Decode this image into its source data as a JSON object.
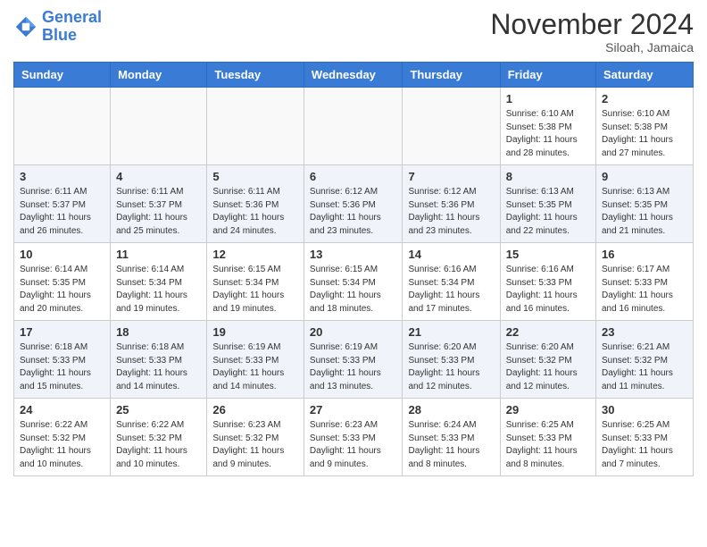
{
  "header": {
    "logo_line1": "General",
    "logo_line2": "Blue",
    "month_title": "November 2024",
    "subtitle": "Siloah, Jamaica"
  },
  "weekdays": [
    "Sunday",
    "Monday",
    "Tuesday",
    "Wednesday",
    "Thursday",
    "Friday",
    "Saturday"
  ],
  "weeks": [
    [
      {
        "day": "",
        "info": ""
      },
      {
        "day": "",
        "info": ""
      },
      {
        "day": "",
        "info": ""
      },
      {
        "day": "",
        "info": ""
      },
      {
        "day": "",
        "info": ""
      },
      {
        "day": "1",
        "info": "Sunrise: 6:10 AM\nSunset: 5:38 PM\nDaylight: 11 hours\nand 28 minutes."
      },
      {
        "day": "2",
        "info": "Sunrise: 6:10 AM\nSunset: 5:38 PM\nDaylight: 11 hours\nand 27 minutes."
      }
    ],
    [
      {
        "day": "3",
        "info": "Sunrise: 6:11 AM\nSunset: 5:37 PM\nDaylight: 11 hours\nand 26 minutes."
      },
      {
        "day": "4",
        "info": "Sunrise: 6:11 AM\nSunset: 5:37 PM\nDaylight: 11 hours\nand 25 minutes."
      },
      {
        "day": "5",
        "info": "Sunrise: 6:11 AM\nSunset: 5:36 PM\nDaylight: 11 hours\nand 24 minutes."
      },
      {
        "day": "6",
        "info": "Sunrise: 6:12 AM\nSunset: 5:36 PM\nDaylight: 11 hours\nand 23 minutes."
      },
      {
        "day": "7",
        "info": "Sunrise: 6:12 AM\nSunset: 5:36 PM\nDaylight: 11 hours\nand 23 minutes."
      },
      {
        "day": "8",
        "info": "Sunrise: 6:13 AM\nSunset: 5:35 PM\nDaylight: 11 hours\nand 22 minutes."
      },
      {
        "day": "9",
        "info": "Sunrise: 6:13 AM\nSunset: 5:35 PM\nDaylight: 11 hours\nand 21 minutes."
      }
    ],
    [
      {
        "day": "10",
        "info": "Sunrise: 6:14 AM\nSunset: 5:35 PM\nDaylight: 11 hours\nand 20 minutes."
      },
      {
        "day": "11",
        "info": "Sunrise: 6:14 AM\nSunset: 5:34 PM\nDaylight: 11 hours\nand 19 minutes."
      },
      {
        "day": "12",
        "info": "Sunrise: 6:15 AM\nSunset: 5:34 PM\nDaylight: 11 hours\nand 19 minutes."
      },
      {
        "day": "13",
        "info": "Sunrise: 6:15 AM\nSunset: 5:34 PM\nDaylight: 11 hours\nand 18 minutes."
      },
      {
        "day": "14",
        "info": "Sunrise: 6:16 AM\nSunset: 5:34 PM\nDaylight: 11 hours\nand 17 minutes."
      },
      {
        "day": "15",
        "info": "Sunrise: 6:16 AM\nSunset: 5:33 PM\nDaylight: 11 hours\nand 16 minutes."
      },
      {
        "day": "16",
        "info": "Sunrise: 6:17 AM\nSunset: 5:33 PM\nDaylight: 11 hours\nand 16 minutes."
      }
    ],
    [
      {
        "day": "17",
        "info": "Sunrise: 6:18 AM\nSunset: 5:33 PM\nDaylight: 11 hours\nand 15 minutes."
      },
      {
        "day": "18",
        "info": "Sunrise: 6:18 AM\nSunset: 5:33 PM\nDaylight: 11 hours\nand 14 minutes."
      },
      {
        "day": "19",
        "info": "Sunrise: 6:19 AM\nSunset: 5:33 PM\nDaylight: 11 hours\nand 14 minutes."
      },
      {
        "day": "20",
        "info": "Sunrise: 6:19 AM\nSunset: 5:33 PM\nDaylight: 11 hours\nand 13 minutes."
      },
      {
        "day": "21",
        "info": "Sunrise: 6:20 AM\nSunset: 5:33 PM\nDaylight: 11 hours\nand 12 minutes."
      },
      {
        "day": "22",
        "info": "Sunrise: 6:20 AM\nSunset: 5:32 PM\nDaylight: 11 hours\nand 12 minutes."
      },
      {
        "day": "23",
        "info": "Sunrise: 6:21 AM\nSunset: 5:32 PM\nDaylight: 11 hours\nand 11 minutes."
      }
    ],
    [
      {
        "day": "24",
        "info": "Sunrise: 6:22 AM\nSunset: 5:32 PM\nDaylight: 11 hours\nand 10 minutes."
      },
      {
        "day": "25",
        "info": "Sunrise: 6:22 AM\nSunset: 5:32 PM\nDaylight: 11 hours\nand 10 minutes."
      },
      {
        "day": "26",
        "info": "Sunrise: 6:23 AM\nSunset: 5:32 PM\nDaylight: 11 hours\nand 9 minutes."
      },
      {
        "day": "27",
        "info": "Sunrise: 6:23 AM\nSunset: 5:33 PM\nDaylight: 11 hours\nand 9 minutes."
      },
      {
        "day": "28",
        "info": "Sunrise: 6:24 AM\nSunset: 5:33 PM\nDaylight: 11 hours\nand 8 minutes."
      },
      {
        "day": "29",
        "info": "Sunrise: 6:25 AM\nSunset: 5:33 PM\nDaylight: 11 hours\nand 8 minutes."
      },
      {
        "day": "30",
        "info": "Sunrise: 6:25 AM\nSunset: 5:33 PM\nDaylight: 11 hours\nand 7 minutes."
      }
    ]
  ]
}
